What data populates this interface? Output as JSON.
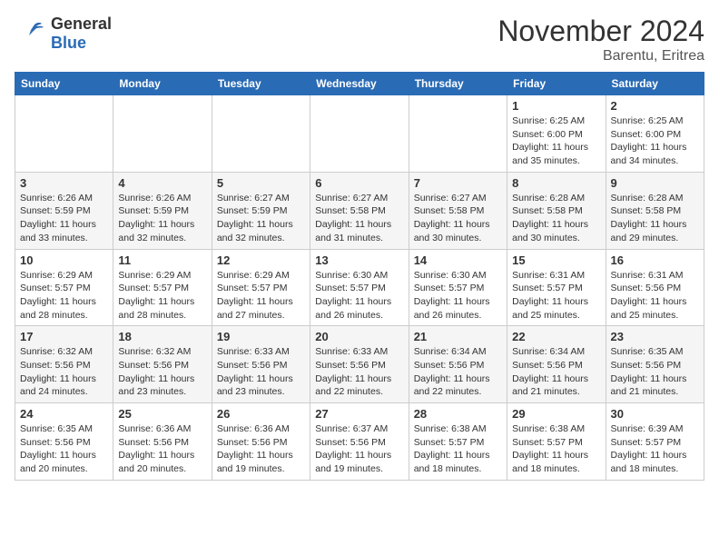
{
  "logo": {
    "general": "General",
    "blue": "Blue"
  },
  "header": {
    "month": "November 2024",
    "location": "Barentu, Eritrea"
  },
  "days_of_week": [
    "Sunday",
    "Monday",
    "Tuesday",
    "Wednesday",
    "Thursday",
    "Friday",
    "Saturday"
  ],
  "weeks": [
    [
      {
        "day": "",
        "info": ""
      },
      {
        "day": "",
        "info": ""
      },
      {
        "day": "",
        "info": ""
      },
      {
        "day": "",
        "info": ""
      },
      {
        "day": "",
        "info": ""
      },
      {
        "day": "1",
        "info": "Sunrise: 6:25 AM\nSunset: 6:00 PM\nDaylight: 11 hours and 35 minutes."
      },
      {
        "day": "2",
        "info": "Sunrise: 6:25 AM\nSunset: 6:00 PM\nDaylight: 11 hours and 34 minutes."
      }
    ],
    [
      {
        "day": "3",
        "info": "Sunrise: 6:26 AM\nSunset: 5:59 PM\nDaylight: 11 hours and 33 minutes."
      },
      {
        "day": "4",
        "info": "Sunrise: 6:26 AM\nSunset: 5:59 PM\nDaylight: 11 hours and 32 minutes."
      },
      {
        "day": "5",
        "info": "Sunrise: 6:27 AM\nSunset: 5:59 PM\nDaylight: 11 hours and 32 minutes."
      },
      {
        "day": "6",
        "info": "Sunrise: 6:27 AM\nSunset: 5:58 PM\nDaylight: 11 hours and 31 minutes."
      },
      {
        "day": "7",
        "info": "Sunrise: 6:27 AM\nSunset: 5:58 PM\nDaylight: 11 hours and 30 minutes."
      },
      {
        "day": "8",
        "info": "Sunrise: 6:28 AM\nSunset: 5:58 PM\nDaylight: 11 hours and 30 minutes."
      },
      {
        "day": "9",
        "info": "Sunrise: 6:28 AM\nSunset: 5:58 PM\nDaylight: 11 hours and 29 minutes."
      }
    ],
    [
      {
        "day": "10",
        "info": "Sunrise: 6:29 AM\nSunset: 5:57 PM\nDaylight: 11 hours and 28 minutes."
      },
      {
        "day": "11",
        "info": "Sunrise: 6:29 AM\nSunset: 5:57 PM\nDaylight: 11 hours and 28 minutes."
      },
      {
        "day": "12",
        "info": "Sunrise: 6:29 AM\nSunset: 5:57 PM\nDaylight: 11 hours and 27 minutes."
      },
      {
        "day": "13",
        "info": "Sunrise: 6:30 AM\nSunset: 5:57 PM\nDaylight: 11 hours and 26 minutes."
      },
      {
        "day": "14",
        "info": "Sunrise: 6:30 AM\nSunset: 5:57 PM\nDaylight: 11 hours and 26 minutes."
      },
      {
        "day": "15",
        "info": "Sunrise: 6:31 AM\nSunset: 5:57 PM\nDaylight: 11 hours and 25 minutes."
      },
      {
        "day": "16",
        "info": "Sunrise: 6:31 AM\nSunset: 5:56 PM\nDaylight: 11 hours and 25 minutes."
      }
    ],
    [
      {
        "day": "17",
        "info": "Sunrise: 6:32 AM\nSunset: 5:56 PM\nDaylight: 11 hours and 24 minutes."
      },
      {
        "day": "18",
        "info": "Sunrise: 6:32 AM\nSunset: 5:56 PM\nDaylight: 11 hours and 23 minutes."
      },
      {
        "day": "19",
        "info": "Sunrise: 6:33 AM\nSunset: 5:56 PM\nDaylight: 11 hours and 23 minutes."
      },
      {
        "day": "20",
        "info": "Sunrise: 6:33 AM\nSunset: 5:56 PM\nDaylight: 11 hours and 22 minutes."
      },
      {
        "day": "21",
        "info": "Sunrise: 6:34 AM\nSunset: 5:56 PM\nDaylight: 11 hours and 22 minutes."
      },
      {
        "day": "22",
        "info": "Sunrise: 6:34 AM\nSunset: 5:56 PM\nDaylight: 11 hours and 21 minutes."
      },
      {
        "day": "23",
        "info": "Sunrise: 6:35 AM\nSunset: 5:56 PM\nDaylight: 11 hours and 21 minutes."
      }
    ],
    [
      {
        "day": "24",
        "info": "Sunrise: 6:35 AM\nSunset: 5:56 PM\nDaylight: 11 hours and 20 minutes."
      },
      {
        "day": "25",
        "info": "Sunrise: 6:36 AM\nSunset: 5:56 PM\nDaylight: 11 hours and 20 minutes."
      },
      {
        "day": "26",
        "info": "Sunrise: 6:36 AM\nSunset: 5:56 PM\nDaylight: 11 hours and 19 minutes."
      },
      {
        "day": "27",
        "info": "Sunrise: 6:37 AM\nSunset: 5:56 PM\nDaylight: 11 hours and 19 minutes."
      },
      {
        "day": "28",
        "info": "Sunrise: 6:38 AM\nSunset: 5:57 PM\nDaylight: 11 hours and 18 minutes."
      },
      {
        "day": "29",
        "info": "Sunrise: 6:38 AM\nSunset: 5:57 PM\nDaylight: 11 hours and 18 minutes."
      },
      {
        "day": "30",
        "info": "Sunrise: 6:39 AM\nSunset: 5:57 PM\nDaylight: 11 hours and 18 minutes."
      }
    ]
  ]
}
